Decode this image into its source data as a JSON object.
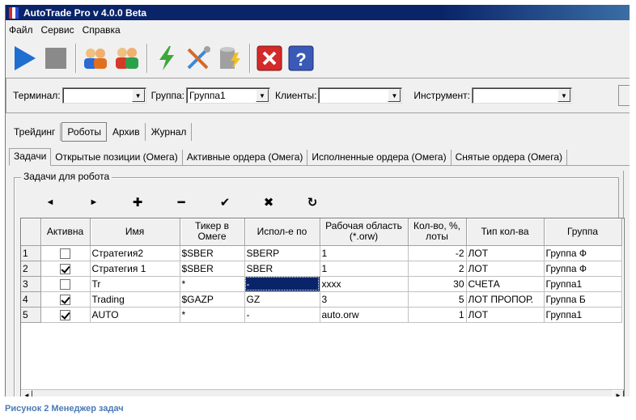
{
  "window": {
    "title": "AutoTrade Pro v 4.0.0 Beta"
  },
  "menu": [
    "Файл",
    "Сервис",
    "Справка"
  ],
  "toolbar": [
    {
      "icon": "play-icon",
      "color": "#1e6fd0"
    },
    {
      "icon": "stop-icon",
      "color": "#808080"
    },
    {
      "icon": "users-icon"
    },
    {
      "icon": "users-group-icon"
    },
    {
      "icon": "lightning-icon"
    },
    {
      "icon": "tools-icon"
    },
    {
      "icon": "database-icon"
    },
    {
      "icon": "close-icon",
      "color": "#d42a2a"
    },
    {
      "icon": "help-icon",
      "color": "#3a5ab8"
    }
  ],
  "filters": {
    "terminal_label": "Терминал:",
    "terminal_value": "",
    "group_label": "Группа:",
    "group_value": "Группа1",
    "clients_label": "Клиенты:",
    "clients_value": "",
    "instrument_label": "Инструмент:",
    "instrument_value": ""
  },
  "section_tabs": [
    "Трейдинг",
    "Роботы",
    "Архив",
    "Журнал"
  ],
  "active_section": "Роботы",
  "sub_tabs": [
    "Задачи",
    "Открытые позиции (Омега)",
    "Активные ордера (Омега)",
    "Исполненные ордера (Омега)",
    "Снятые ордера (Омега)"
  ],
  "active_sub_tab": "Задачи",
  "groupbox_title": "Задачи для робота",
  "nav_buttons": [
    "◄",
    "►",
    "✚",
    "━",
    "✔",
    "✖",
    "↻"
  ],
  "grid": {
    "columns": [
      "",
      "Активна",
      "Имя",
      "Тикер в Омеге",
      "Испол-е по",
      "Рабочая область (*.orw)",
      "Кол-во, %, лоты",
      "Тип кол-ва",
      "Группа"
    ],
    "rows": [
      {
        "num": "1",
        "active": false,
        "name": "Стратегия2",
        "ticker": "$SBER",
        "exec": "SBERP",
        "area": "1",
        "qty": "-2",
        "qty_type": "ЛОТ",
        "group": "Группа Ф"
      },
      {
        "num": "2",
        "active": true,
        "name": "Стратегия 1",
        "ticker": "$SBER",
        "exec": "SBER",
        "area": " 1",
        "qty": "2",
        "qty_type": "ЛОТ",
        "group": "Группа Ф"
      },
      {
        "num": "3",
        "active": false,
        "name": "Tr",
        "ticker": "*",
        "exec": "-",
        "area": "xxxx",
        "qty": "30",
        "qty_type": "СЧЕТА",
        "group": "Группа1"
      },
      {
        "num": "4",
        "active": true,
        "name": "Trading",
        "ticker": "$GAZP",
        "exec": "GZ",
        "area": "3",
        "qty": "5",
        "qty_type": "ЛОТ ПРОПОР.",
        "group": "Группа Б"
      },
      {
        "num": "5",
        "active": true,
        "name": "AUTO",
        "ticker": "*",
        "exec": "-",
        "area": "auto.orw",
        "qty": "1",
        "qty_type": "ЛОТ",
        "group": "Группа1"
      }
    ]
  },
  "caption": "Рисунок 2 Менеджер задач"
}
